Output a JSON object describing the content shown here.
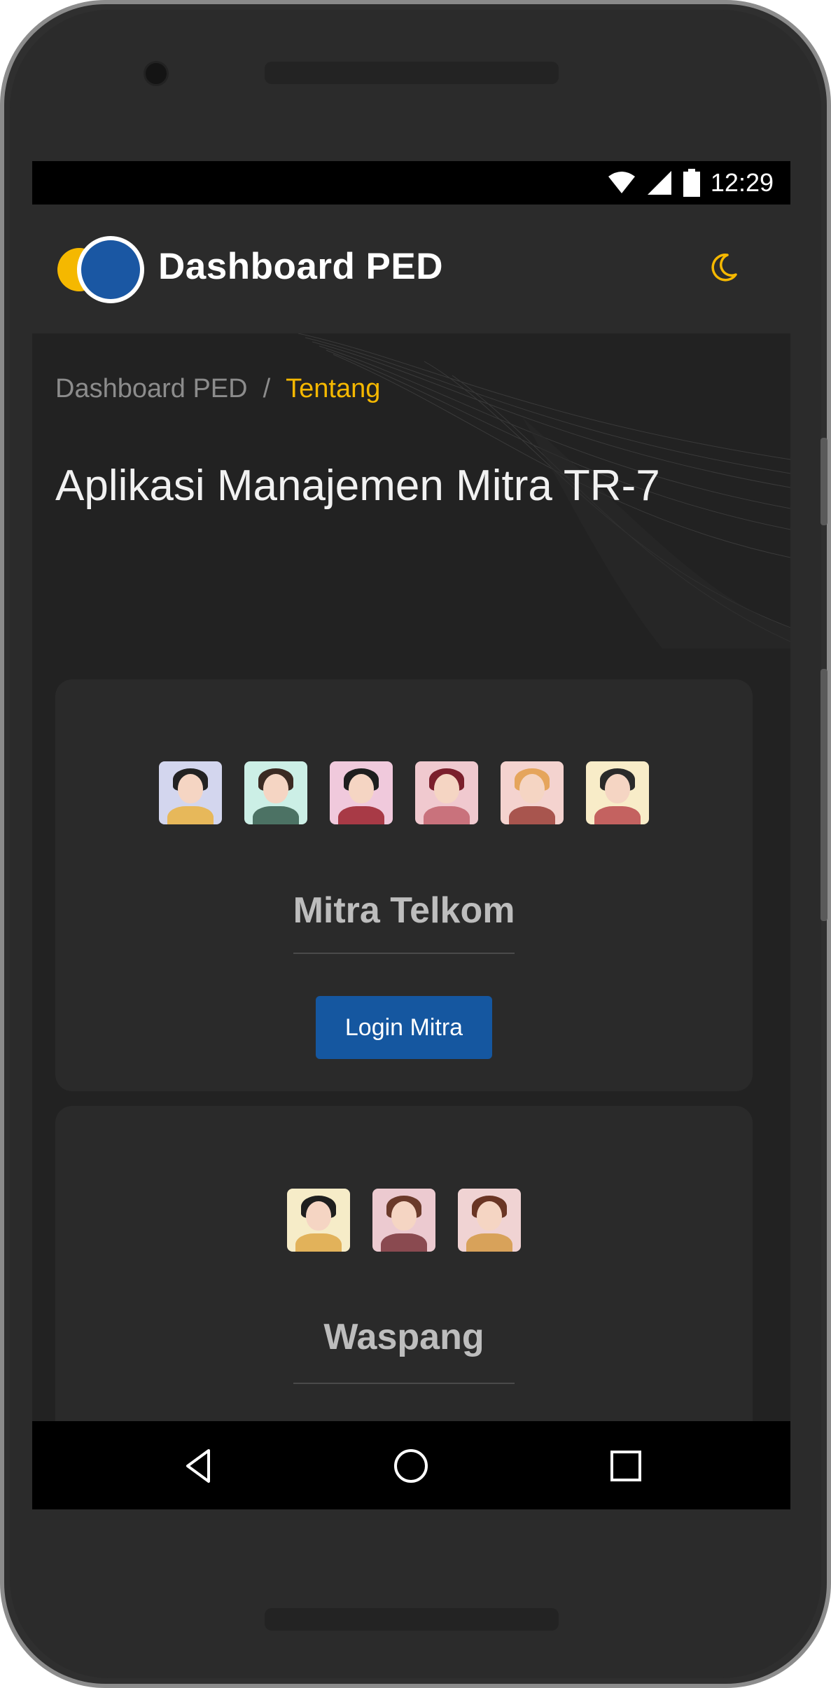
{
  "status_bar": {
    "time": "12:29",
    "icons": [
      "wifi-icon",
      "signal-icon",
      "battery-icon"
    ]
  },
  "header": {
    "brand": "Dashboard PED",
    "theme_toggle_icon": "moon-icon"
  },
  "breadcrumb": {
    "home": "Dashboard PED",
    "separator": "/",
    "current": "Tentang"
  },
  "page": {
    "title": "Aplikasi Manajemen Mitra TR-7"
  },
  "cards": [
    {
      "title": "Mitra Telkom",
      "button": "Login Mitra",
      "avatar_count": 6
    },
    {
      "title": "Waspang",
      "avatar_count": 3
    }
  ],
  "colors": {
    "accent": "#f5b800",
    "primary": "#1557a0",
    "background": "#222222",
    "card": "#2a2a2a"
  },
  "nav": [
    "back-icon",
    "home-icon",
    "recents-icon"
  ]
}
